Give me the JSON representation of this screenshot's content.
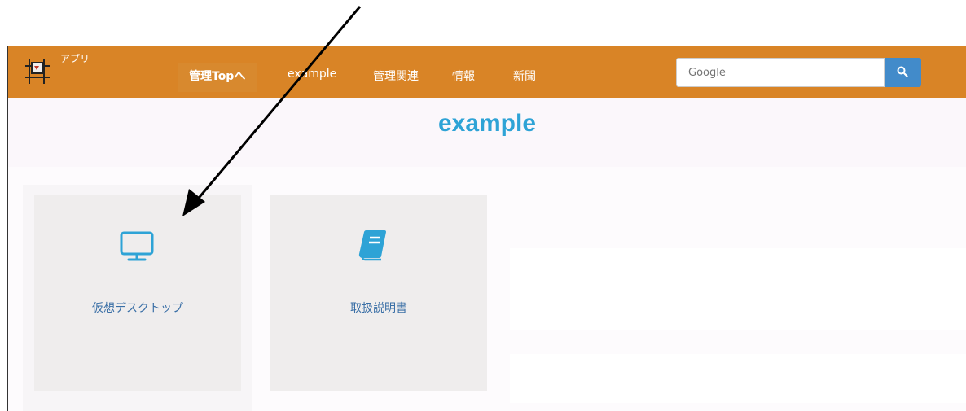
{
  "navbar": {
    "brand_label": "アプリ",
    "items": [
      {
        "label": "管理Topへ"
      },
      {
        "label": "example"
      },
      {
        "label": "管理関連"
      },
      {
        "label": "情報"
      },
      {
        "label": "新聞"
      }
    ],
    "search": {
      "placeholder": "Google",
      "button_icon": "search-icon"
    },
    "color": "#d98426"
  },
  "main": {
    "title": "example",
    "title_color": "#2ea3d6",
    "cards": [
      {
        "label": "仮想デスクトップ",
        "icon": "monitor-icon"
      },
      {
        "label": "取扱説明書",
        "icon": "book-icon"
      }
    ]
  }
}
